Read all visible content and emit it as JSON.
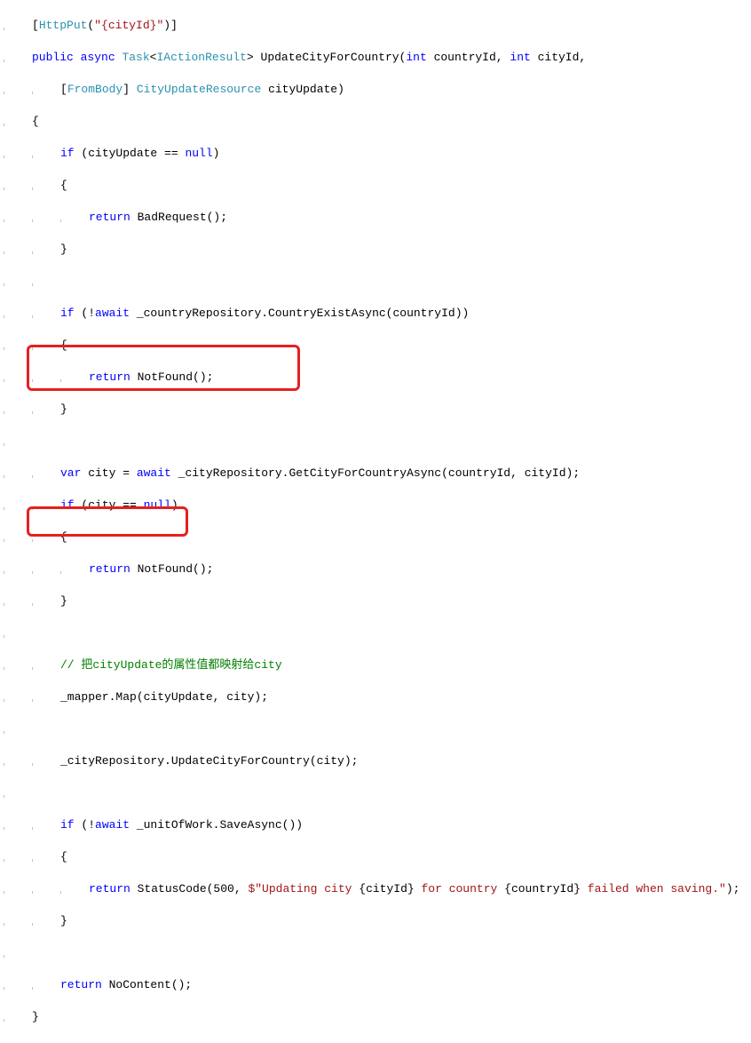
{
  "tokens": {
    "attrL": "[",
    "attrName": "HttpPut",
    "attrP": "(",
    "attrStr": "\"{cityId}\"",
    "attrPE": ")",
    "attrR": "]",
    "public": "public",
    "async": "async",
    "task": "Task",
    "lt": "<",
    "iaction": "IActionResult",
    "gt": ">",
    "method": " UpdateCityForCountry(",
    "int1": "int",
    "p1": " countryId, ",
    "int2": "int",
    "p2": " cityId,",
    "frombodyL": "[",
    "frombody": "FromBody",
    "frombodyR": "] ",
    "cityUpdRes": "CityUpdateResource",
    "p3": " cityUpdate)",
    "lb": "{",
    "rb": "}",
    "if": "if",
    "ifCond1a": " (cityUpdate == ",
    "null": "null",
    "ifCond1b": ")",
    "return": "return",
    "badreq": " BadRequest();",
    "await": "await",
    "ifCond2a": " (!",
    "ifCond2b": " _countryRepository.CountryExistAsync(countryId))",
    "notfound": " NotFound();",
    "var": "var",
    "cityDecl1": " city = ",
    "cityDecl2": " _cityRepository.GetCityForCountryAsync(countryId, cityId);",
    "ifCond3a": " (city == ",
    "ifCond3b": ")",
    "comment1": "// 把cityUpdate的属性值都映射给city",
    "mapperMap": "_mapper.Map(cityUpdate, city);",
    "updateCity": "_cityRepository.UpdateCityForCountry(city);",
    "ifCond4a": " (!",
    "ifCond4b": " _unitOfWork.SaveAsync())",
    "statusCodeA": " StatusCode(500, ",
    "interpStart": "$\"",
    "interpText1": "Updating city ",
    "interpBrace1O": "{",
    "interpExpr1": "cityId",
    "interpBrace1C": "}",
    "interpText2": " for country ",
    "interpBrace2O": "{",
    "interpExpr2": "countryId",
    "interpBrace2C": "}",
    "interpText3": " failed when saving.",
    "interpEnd": "\"",
    "statusCodeB": ");",
    "nocontent": " NoContent();"
  }
}
